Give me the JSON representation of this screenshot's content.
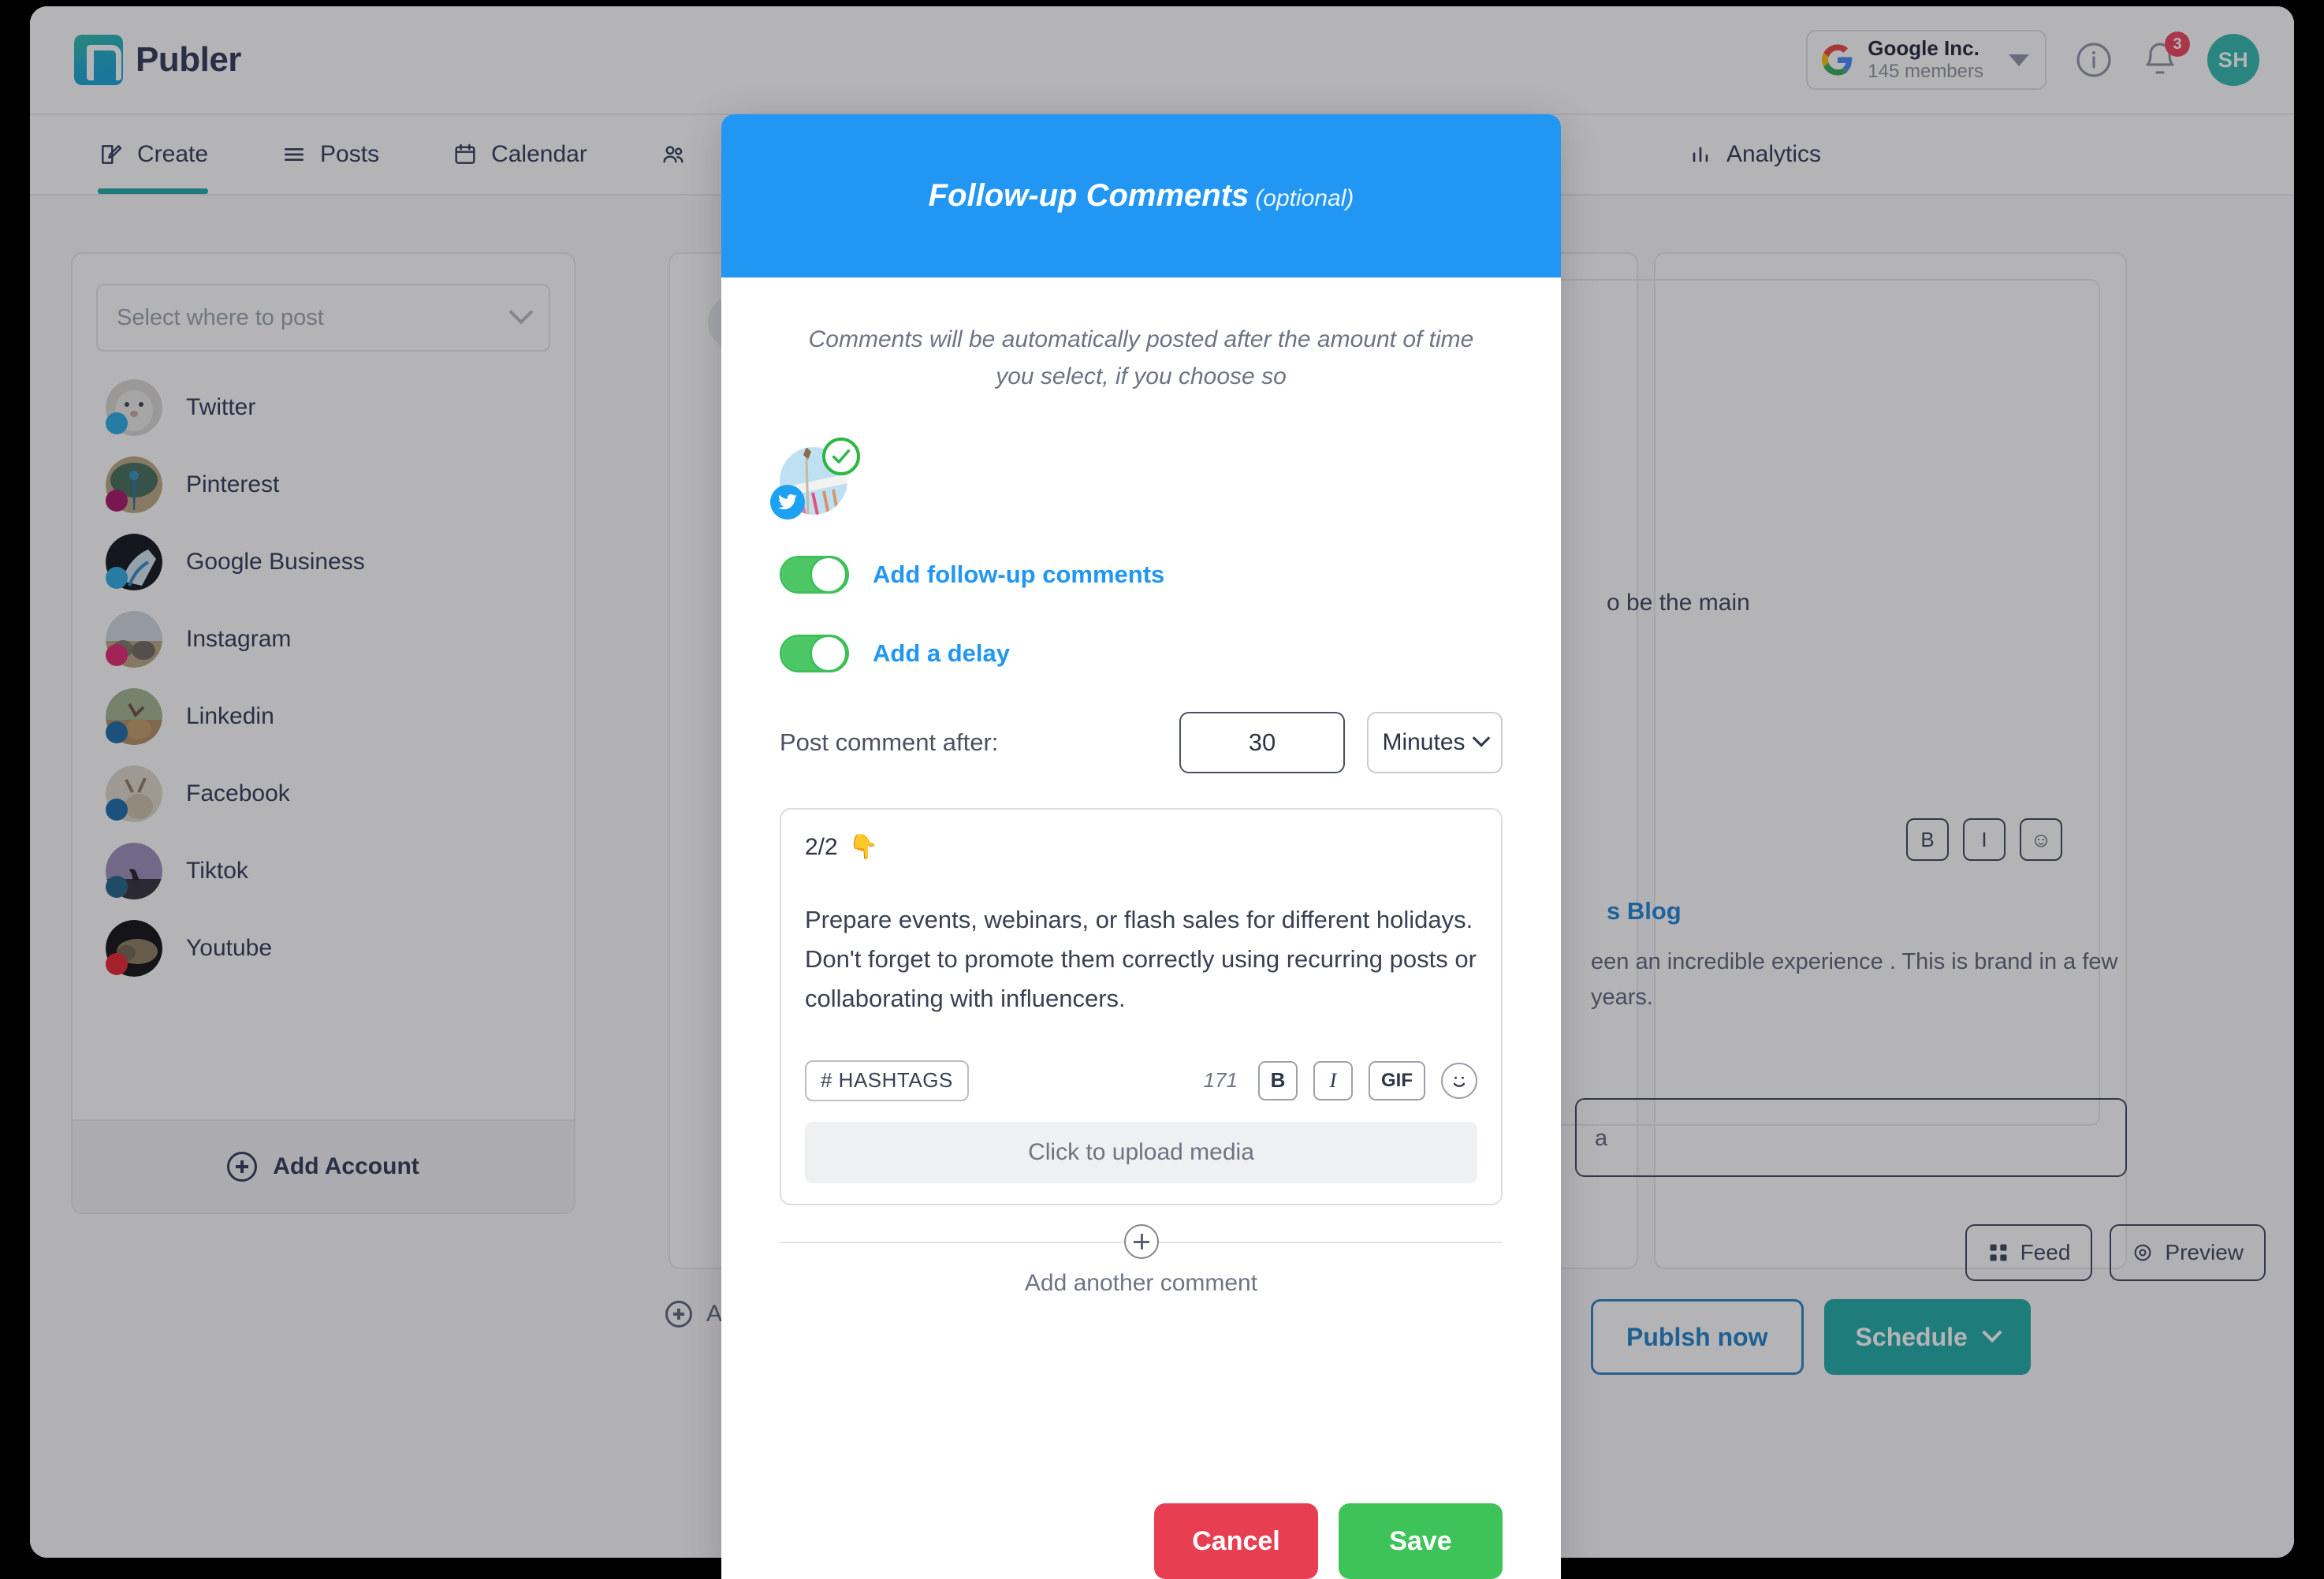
{
  "app": {
    "brand_name": "Publer",
    "org": {
      "name": "Google Inc.",
      "members": "145 members"
    },
    "notifications_count": "3",
    "user_initials": "SH",
    "nav": [
      {
        "label": "Create",
        "icon": "edit-icon",
        "active": true
      },
      {
        "label": "Posts",
        "icon": "list-icon",
        "active": false
      },
      {
        "label": "Calendar",
        "icon": "calendar-icon",
        "active": false
      },
      {
        "label": "Analytics",
        "icon": "bar-chart-icon",
        "active": false
      }
    ]
  },
  "sidebar": {
    "select_placeholder": "Select where to post",
    "accounts": [
      {
        "label": "Twitter",
        "dot_color": "#23a8e0"
      },
      {
        "label": "Pinterest",
        "dot_color": "#a50e62"
      },
      {
        "label": "Google Business",
        "dot_color": "#29a8e0"
      },
      {
        "label": "Instagram",
        "dot_color": "#e0226e"
      },
      {
        "label": "Linkedin",
        "dot_color": "#1668a8"
      },
      {
        "label": "Facebook",
        "dot_color": "#1668a8"
      },
      {
        "label": "Tiktok",
        "dot_color": "#1d5e85"
      },
      {
        "label": "Youtube",
        "dot_color": "#e8202a"
      }
    ],
    "add_account_label": "Add Account",
    "add_label": "Add"
  },
  "right_panel": {
    "text_line_1": "o be the main",
    "blog_link": "s Blog",
    "body_text": "een an incredible experience . This is brand in a few years.",
    "input_value": "a",
    "format_buttons": [
      "B",
      "I",
      "☺"
    ],
    "chips": [
      {
        "label": "Feed",
        "icon": "grid-icon"
      },
      {
        "label": "Preview",
        "icon": "eye-icon"
      }
    ],
    "publish_label": "Publsh now",
    "schedule_label": "Schedule"
  },
  "modal": {
    "title": "Follow-up Comments",
    "title_optional": "(optional)",
    "description": "Comments will be automatically posted after the amount of time you select, if you choose so",
    "account_platform": "twitter-icon",
    "account_selected": true,
    "toggles": [
      {
        "label": "Add follow-up comments",
        "on": true
      },
      {
        "label": "Add a delay",
        "on": true
      }
    ],
    "delay": {
      "label": "Post comment after:",
      "value": "30",
      "unit": "Minutes"
    },
    "comment": {
      "index": "2/2",
      "index_emoji": "👇",
      "text": "Prepare events, webinars, or flash sales for different holidays. Don't forget to promote them correctly using recurring posts or collaborating with influencers.",
      "hashtags_label": "# HASHTAGS",
      "char_count": "171",
      "bold_label": "B",
      "italic_label": "I",
      "gif_label": "GIF",
      "emoji_icon": "smiley-icon",
      "upload_label": "Click to upload media"
    },
    "add_another_label": "Add another comment",
    "cancel_label": "Cancel",
    "save_label": "Save"
  },
  "colors": {
    "modal_header": "#2196f3",
    "toggle_on": "#4dc766",
    "cancel": "#e83e52",
    "save": "#3ec359",
    "brand_teal": "#1aa9a1",
    "link_blue": "#2196f3"
  }
}
